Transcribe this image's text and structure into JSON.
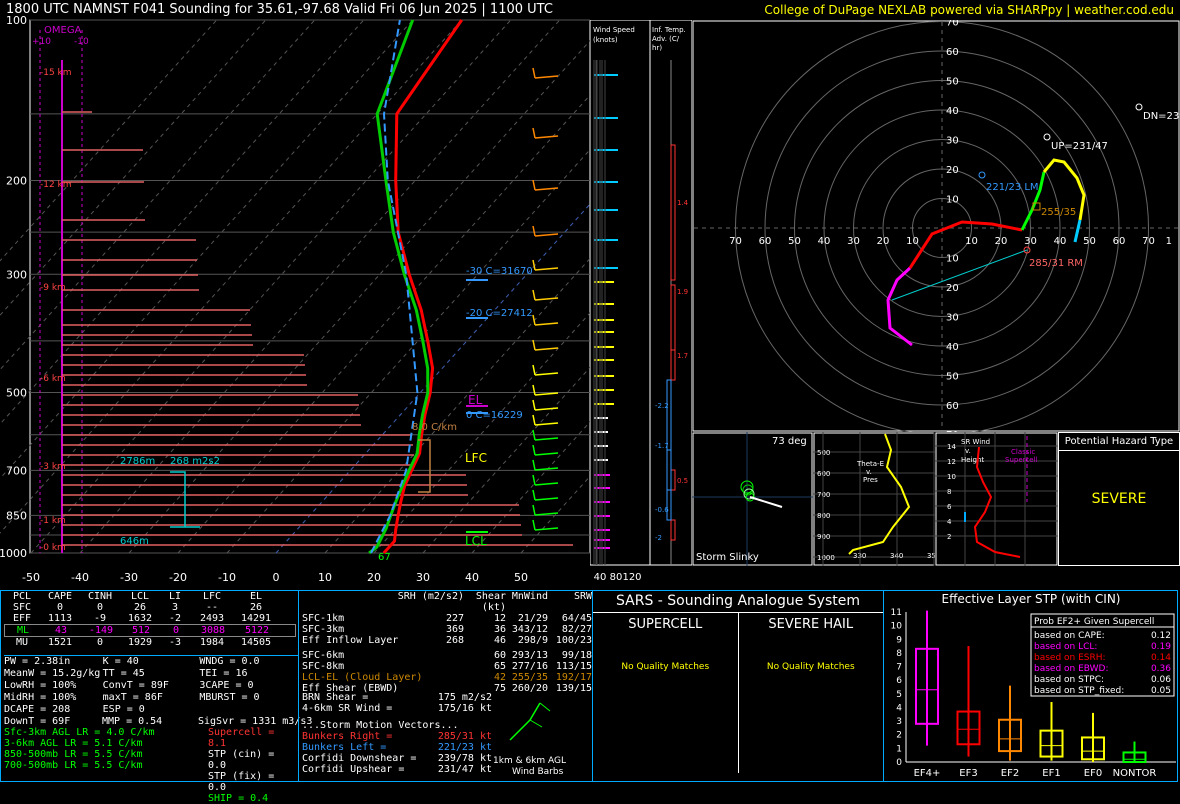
{
  "header": {
    "title": "1800 UTC NAMNST F041 Sounding for 35.61,-97.68 Valid  Fri 06 Jun 2025 | 1100 UTC",
    "credit": "College of DuPage NEXLAB powered via SHARPpy | weather.cod.edu"
  },
  "skewt": {
    "p_ticks": [
      "100",
      "200",
      "300",
      "500",
      "700",
      "850",
      "1000"
    ],
    "t_ticks": [
      "-50",
      "-40",
      "-30",
      "-20",
      "-10",
      "0",
      "10",
      "20",
      "30",
      "40",
      "50"
    ],
    "omega_label": "OMEGA",
    "omega_left": "+10",
    "omega_right": "-10",
    "km_labels": [
      "15 km",
      "12 km",
      "9 km",
      "6 km",
      "3 km",
      "1 km",
      "0 km"
    ],
    "annotations": {
      "m30": "-30 C=31670",
      "m20": "-20 C=27412",
      "zero": "0 C=16229",
      "lapse": "8.0 C/km",
      "el": "EL",
      "lfc": "LFC",
      "lcl": "LCL",
      "hgt": "2786m",
      "srh": "268 m2s2",
      "bot": "646m",
      "sfc_td": "67"
    }
  },
  "wind_panel": {
    "title": "Wind Speed (knots)",
    "ticks": [
      "40",
      "80",
      "120"
    ]
  },
  "tadv_panel": {
    "title": "Inf. Temp. Adv. (C/ hr)",
    "values": [
      "1.4",
      "1.9",
      "1.7",
      "-2.2",
      "-1.7",
      "0.5",
      "-0.6",
      "-2"
    ]
  },
  "hodo": {
    "rings": [
      "10",
      "20",
      "30",
      "40",
      "50",
      "60",
      "70"
    ],
    "labels": {
      "dn": "DN=239",
      "up": "UP=231/47",
      "lm": "221/23 LM",
      "rm": "285/31 RM",
      "mean": "255/35"
    }
  },
  "slinky": {
    "deg": "73 deg",
    "label": "Storm Slinky"
  },
  "theta_e": {
    "label": "Theta-E v. Pres",
    "yticks": [
      "500",
      "600",
      "700",
      "800",
      "900",
      "1000"
    ],
    "xticks": [
      "330",
      "340",
      "350",
      "360"
    ]
  },
  "srwind": {
    "label": "SR Wind v. Height",
    "note": "Classic Supercell",
    "yticks": [
      "14",
      "12",
      "10",
      "8",
      "6",
      "4",
      "2"
    ]
  },
  "hazard": {
    "title": "Potential Hazard Type",
    "value": "SEVERE"
  },
  "parcels": {
    "headers": [
      "PCL",
      "CAPE",
      "CINH",
      "LCL",
      "LI",
      "LFC",
      "EL"
    ],
    "rows": [
      [
        "SFC",
        "0",
        "0",
        "26",
        "3",
        "--",
        "26"
      ],
      [
        "EFF",
        "1113",
        "-9",
        "1632",
        "-2",
        "2493",
        "14291"
      ],
      [
        "ML",
        "43",
        "-149",
        "512",
        "0",
        "3088",
        "5122"
      ],
      [
        "MU",
        "1521",
        "0",
        "1929",
        "-3",
        "1984",
        "14505"
      ]
    ]
  },
  "indices": [
    [
      "PW = 2.38in",
      "K = 40",
      "WNDG = 0.0"
    ],
    [
      "MeanW = 15.2g/kg",
      "TT = 45",
      "TEI = 16"
    ],
    [
      "LowRH = 100%",
      "ConvT = 89F",
      "3CAPE = 0"
    ],
    [
      "MidRH = 100%",
      "maxT = 86F",
      "MBURST = 0"
    ],
    [
      "DCAPE = 208",
      "ESP = 0",
      ""
    ],
    [
      "DownT = 69F",
      "MMP = 0.54",
      "SigSvr = 1331 m3/s3"
    ]
  ],
  "lapse": [
    "Sfc-3km AGL LR = 4.0 C/km",
    "3-6km AGL LR = 5.1 C/km",
    "850-500mb LR = 5.5 C/km",
    "700-500mb LR = 5.5 C/km"
  ],
  "composite": [
    "Supercell = 8.1",
    "STP (cin) = 0.0",
    "STP (fix) = 0.0",
    "SHIP = 0.4"
  ],
  "kinematics": {
    "headers": [
      "SRH (m2/s2)",
      "Shear (kt)",
      "MnWind",
      "SRW"
    ],
    "rows": [
      [
        "SFC-1km",
        "227",
        "12",
        "21/29",
        "64/45"
      ],
      [
        "SFC-3km",
        "369",
        "36",
        "343/12",
        "82/27"
      ],
      [
        "Eff Inflow Layer",
        "268",
        "46",
        "298/9",
        "100/23"
      ],
      [
        "SFC-6km",
        "",
        "60",
        "293/13",
        "99/18"
      ],
      [
        "SFC-8km",
        "",
        "65",
        "277/16",
        "113/15"
      ],
      [
        "LCL-EL (Cloud Layer)",
        "",
        "42",
        "255/35",
        "192/17"
      ],
      [
        "Eff Shear (EBWD)",
        "",
        "75",
        "260/20",
        "139/15"
      ]
    ],
    "brn": [
      "BRN Shear =",
      "175 m2/s2"
    ],
    "sr46": [
      "4-6km SR Wind =",
      "175/16 kt"
    ],
    "motion_title": "...Storm Motion Vectors...",
    "motion": [
      [
        "Bunkers Right =",
        "285/31 kt"
      ],
      [
        "Bunkers Left =",
        "221/23 kt"
      ],
      [
        "Corfidi Downshear =",
        "239/78 kt"
      ],
      [
        "Corfidi Upshear =",
        "231/47 kt"
      ]
    ],
    "barbs_label": "1km & 6km AGL Wind Barbs"
  },
  "sars": {
    "title": "SARS - Sounding Analogue System",
    "supercell": "SUPERCELL",
    "hail": "SEVERE HAIL",
    "sup_result": "No Quality Matches",
    "hail_result": "No Quality Matches"
  },
  "stp": {
    "title": "Effective Layer STP (with CIN)",
    "yticks": [
      "0",
      "1",
      "2",
      "3",
      "4",
      "5",
      "6",
      "7",
      "8",
      "9",
      "10",
      "11"
    ],
    "categories": [
      "EF4+",
      "EF3",
      "EF2",
      "EF1",
      "EF0",
      "NONTOR"
    ],
    "prob_title": "Prob EF2+ Given Supercell",
    "probs": [
      [
        "based on CAPE:",
        "0.12"
      ],
      [
        "based on LCL:",
        "0.19"
      ],
      [
        "based on ESRH:",
        "0.14"
      ],
      [
        "based on EBWD:",
        "0.36"
      ],
      [
        "based on STPC:",
        "0.06"
      ],
      [
        "based on STP_fixed:",
        "0.05"
      ]
    ]
  },
  "chart_data": [
    {
      "type": "line",
      "title": "",
      "xlabel": "",
      "ylabel": "",
      "ylim": [
        1000,
        100
      ],
      "xlim": [
        -50,
        50
      ],
      "series": [
        {
          "pressure": [
            1000,
            975,
            950,
            925,
            900,
            850,
            800,
            750,
            700,
            650,
            600,
            550,
            500,
            450,
            400,
            350,
            300,
            250,
            200,
            150,
            100
          ],
          "values": [
            22,
            22,
            22,
            21,
            20,
            18,
            16,
            14,
            12.5,
            11,
            8,
            5,
            2,
            -2,
            -8,
            -15,
            -24,
            -34,
            -44,
            -56,
            -60
          ]
        },
        {
          "pressure": [
            1000,
            975,
            950,
            925,
            900,
            850,
            800,
            750,
            700,
            650,
            600,
            550,
            500,
            450,
            400,
            350,
            300,
            250,
            200,
            150,
            100
          ],
          "values": [
            19,
            19.5,
            19,
            18.5,
            18,
            16.5,
            15,
            13.5,
            12,
            10.5,
            7.5,
            4.5,
            1.5,
            -3,
            -9,
            -16,
            -25,
            -35,
            -46,
            -60,
            -70
          ]
        }
      ]
    },
    {
      "type": "box",
      "title": "Effective Layer STP (with CIN)",
      "categories": [
        "EF4+",
        "EF3",
        "EF2",
        "EF1",
        "EF0",
        "NONTOR"
      ],
      "ylim": [
        0,
        11
      ],
      "boxes": [
        {
          "lo": 1.2,
          "q1": 2.8,
          "med": 5.3,
          "q3": 8.3,
          "hi": 11.1
        },
        {
          "lo": 0.4,
          "q1": 1.3,
          "med": 2.4,
          "q3": 3.7,
          "hi": 8.5
        },
        {
          "lo": 0.1,
          "q1": 0.8,
          "med": 1.7,
          "q3": 3.1,
          "hi": 5.6
        },
        {
          "lo": 0.1,
          "q1": 0.4,
          "med": 1.2,
          "q3": 2.3,
          "hi": 4.4
        },
        {
          "lo": 0,
          "q1": 0.2,
          "med": 0.8,
          "q3": 1.8,
          "hi": 3.6
        },
        {
          "lo": 0,
          "q1": 0,
          "med": 0.2,
          "q3": 0.7,
          "hi": 1.5
        }
      ]
    }
  ]
}
